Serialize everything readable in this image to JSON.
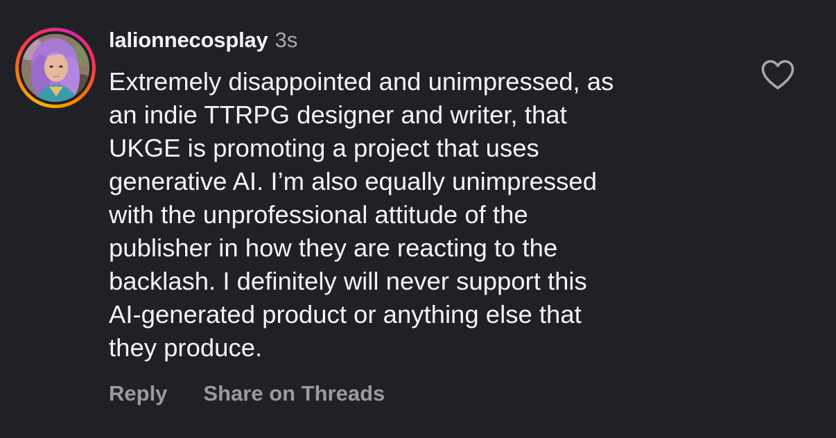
{
  "comment": {
    "username": "lalionnecosplay",
    "timestamp": "3s",
    "text": "Extremely disappointed and unimpressed, as an indie TTRPG designer and writer, that UKGE is promoting a project that uses generative AI. I’m also equally unimpressed with the unprofessional attitude of the publisher in how they are reacting to the backlash. I definitely will never support this AI-generated product or anything else that they produce.",
    "lines": [
      "Extremely disappointed and unimpressed, as",
      "an indie TTRPG designer and writer, that",
      "UKGE is promoting a project that uses",
      "generative AI. I’m also equally unimpressed",
      "with the unprofessional attitude of the",
      "publisher in how they are reacting to the",
      "backlash. I definitely will never support this",
      "AI-generated product or anything else that",
      "they produce."
    ]
  },
  "actions": {
    "reply_label": "Reply",
    "share_label": "Share on Threads"
  },
  "icons": {
    "avatar": "profile-photo",
    "like": "heart-outline-icon"
  },
  "colors": {
    "background": "#202126",
    "text": "#f5f5f5",
    "muted": "#a8a8ae",
    "story_ring": [
      "#f7b500",
      "#ff7a00",
      "#ff2d55",
      "#d62aa0"
    ]
  }
}
